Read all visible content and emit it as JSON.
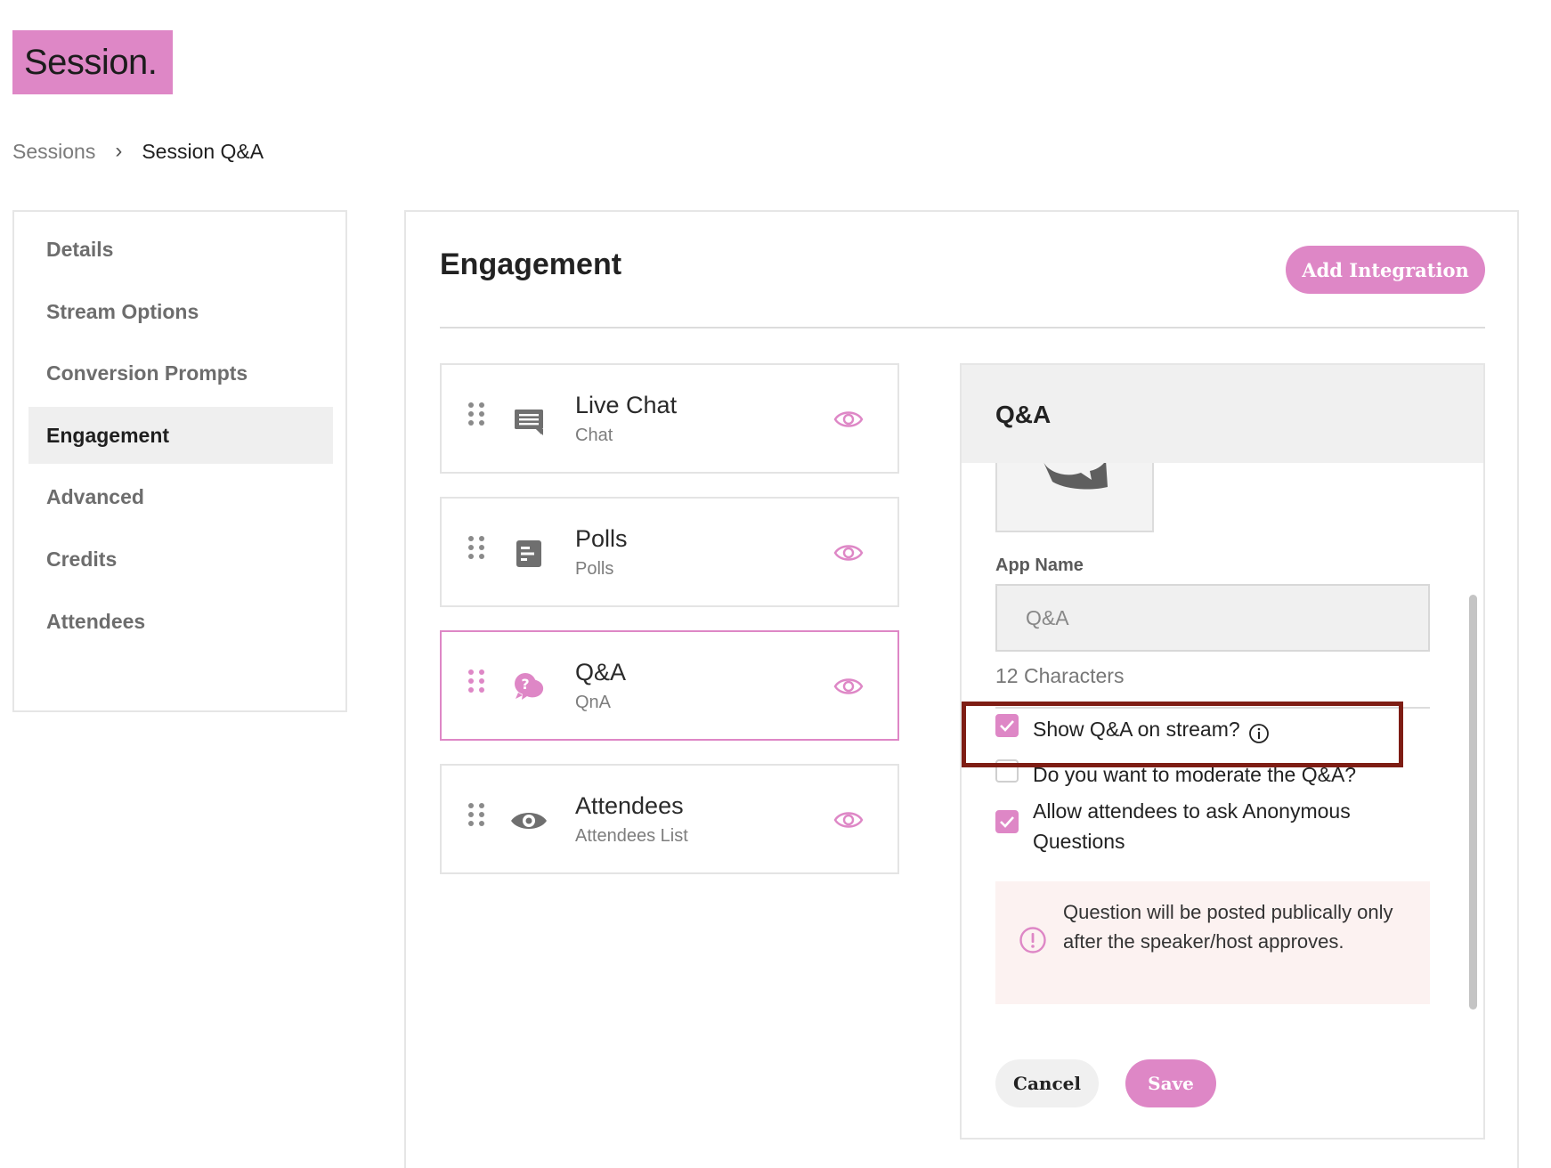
{
  "app": {
    "logo_text": "Session."
  },
  "breadcrumb": {
    "parent": "Sessions",
    "separator": "›",
    "current": "Session Q&A"
  },
  "sidebar": {
    "items": [
      {
        "label": "Details"
      },
      {
        "label": "Stream Options"
      },
      {
        "label": "Conversion Prompts"
      },
      {
        "label": "Engagement",
        "active": true
      },
      {
        "label": "Advanced"
      },
      {
        "label": "Credits"
      },
      {
        "label": "Attendees"
      }
    ]
  },
  "main": {
    "title": "Engagement",
    "add_button_label": "Add Integration",
    "cards": [
      {
        "title": "Live Chat",
        "subtitle": "Chat",
        "icon": "chat-icon"
      },
      {
        "title": "Polls",
        "subtitle": "Polls",
        "icon": "poll-icon"
      },
      {
        "title": "Q&A",
        "subtitle": "QnA",
        "icon": "qna-icon",
        "selected": true
      },
      {
        "title": "Attendees",
        "subtitle": "Attendees List",
        "icon": "eye-icon"
      }
    ]
  },
  "panel": {
    "title": "Q&A",
    "app_name_label": "App Name",
    "app_name_value": "Q&A",
    "char_count": "12 Characters",
    "options": [
      {
        "label": "Show Q&A on stream?",
        "checked": true
      },
      {
        "label": "Do you want to moderate the Q&A?",
        "checked": false
      },
      {
        "label": "Allow attendees to ask Anonymous Questions",
        "checked": true
      }
    ],
    "notice": "Question will be posted publically only after the speaker/host approves.",
    "cancel_label": "Cancel",
    "save_label": "Save"
  },
  "colors": {
    "accent": "#de87c6",
    "highlight_border": "#7e1d14",
    "notice_bg": "#fcf2f1"
  }
}
